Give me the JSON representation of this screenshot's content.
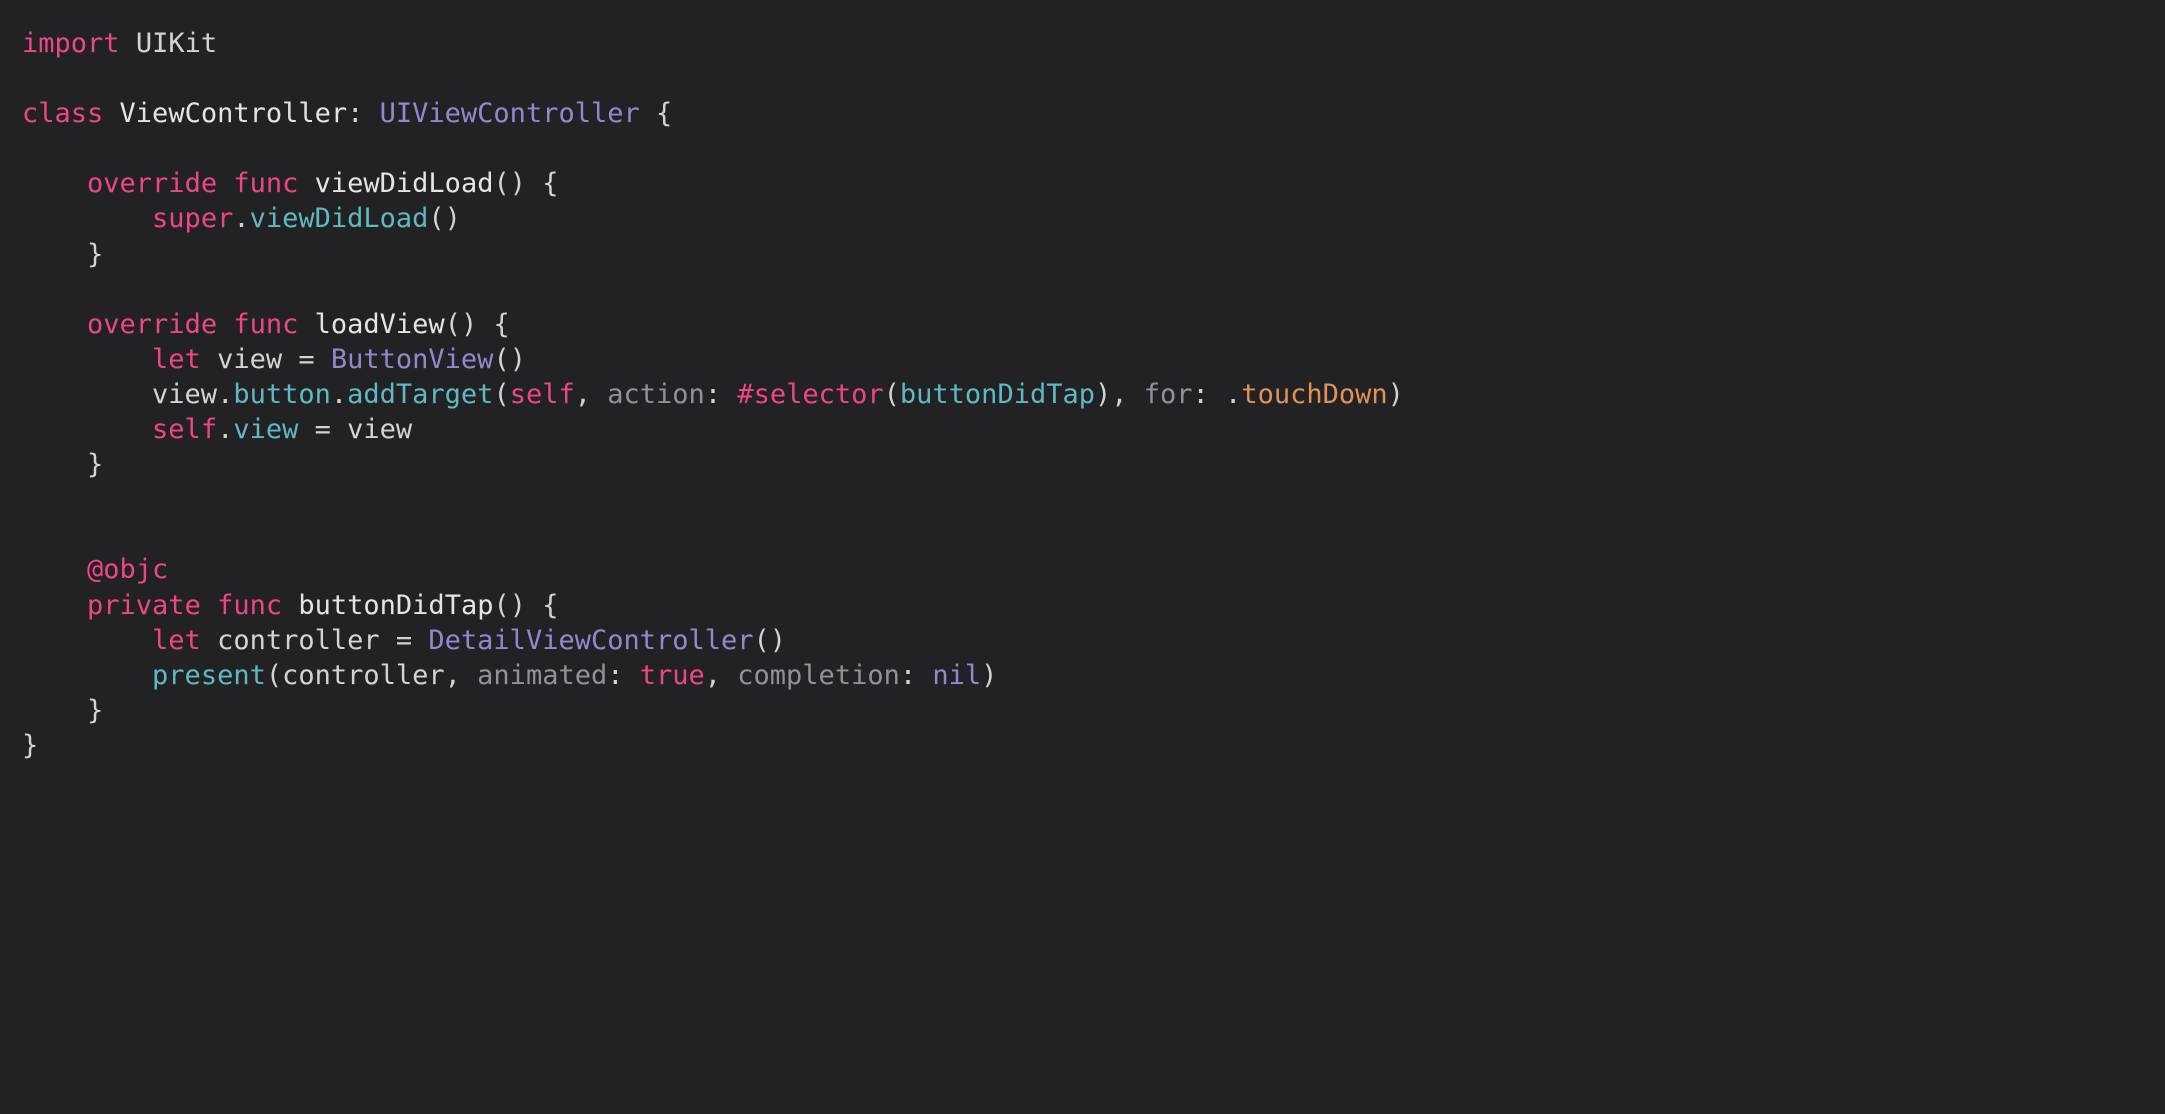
{
  "colors": {
    "keyword": "#ec4689",
    "plain": "#d1d3d4",
    "type": "#9786cd",
    "method": "#5fb9c2",
    "param": "#8e939b",
    "accessor": "#e2e5e7",
    "objc": "#df9355",
    "nil": "#9786cd",
    "punct": "#d1d3d4"
  },
  "code": [
    [
      {
        "t": "import",
        "c": "keyword"
      },
      {
        "t": " ",
        "c": "plain"
      },
      {
        "t": "UIKit",
        "c": "plain"
      }
    ],
    [],
    [
      {
        "t": "class",
        "c": "keyword"
      },
      {
        "t": " ",
        "c": "plain"
      },
      {
        "t": "ViewController",
        "c": "accessor"
      },
      {
        "t": ": ",
        "c": "plain"
      },
      {
        "t": "UIViewController",
        "c": "type"
      },
      {
        "t": " {",
        "c": "plain"
      }
    ],
    [],
    [
      {
        "t": "    ",
        "c": "plain"
      },
      {
        "t": "override",
        "c": "keyword"
      },
      {
        "t": " ",
        "c": "plain"
      },
      {
        "t": "func",
        "c": "keyword"
      },
      {
        "t": " ",
        "c": "plain"
      },
      {
        "t": "viewDidLoad",
        "c": "accessor"
      },
      {
        "t": "() {",
        "c": "plain"
      }
    ],
    [
      {
        "t": "        ",
        "c": "plain"
      },
      {
        "t": "super",
        "c": "keyword"
      },
      {
        "t": ".",
        "c": "plain"
      },
      {
        "t": "viewDidLoad",
        "c": "method"
      },
      {
        "t": "()",
        "c": "plain"
      }
    ],
    [
      {
        "t": "    }",
        "c": "plain"
      }
    ],
    [],
    [
      {
        "t": "    ",
        "c": "plain"
      },
      {
        "t": "override",
        "c": "keyword"
      },
      {
        "t": " ",
        "c": "plain"
      },
      {
        "t": "func",
        "c": "keyword"
      },
      {
        "t": " ",
        "c": "plain"
      },
      {
        "t": "loadView",
        "c": "accessor"
      },
      {
        "t": "() {",
        "c": "plain"
      }
    ],
    [
      {
        "t": "        ",
        "c": "plain"
      },
      {
        "t": "let",
        "c": "keyword"
      },
      {
        "t": " view = ",
        "c": "plain"
      },
      {
        "t": "ButtonView",
        "c": "type"
      },
      {
        "t": "()",
        "c": "plain"
      }
    ],
    [
      {
        "t": "        view.",
        "c": "plain"
      },
      {
        "t": "button",
        "c": "method"
      },
      {
        "t": ".",
        "c": "plain"
      },
      {
        "t": "addTarget",
        "c": "method"
      },
      {
        "t": "(",
        "c": "plain"
      },
      {
        "t": "self",
        "c": "keyword"
      },
      {
        "t": ", ",
        "c": "plain"
      },
      {
        "t": "action",
        "c": "param"
      },
      {
        "t": ": ",
        "c": "plain"
      },
      {
        "t": "#selector",
        "c": "keyword"
      },
      {
        "t": "(",
        "c": "plain"
      },
      {
        "t": "buttonDidTap",
        "c": "method"
      },
      {
        "t": "), ",
        "c": "plain"
      },
      {
        "t": "for",
        "c": "param"
      },
      {
        "t": ": .",
        "c": "plain"
      },
      {
        "t": "touchDown",
        "c": "objc"
      },
      {
        "t": ")",
        "c": "plain"
      }
    ],
    [
      {
        "t": "        ",
        "c": "plain"
      },
      {
        "t": "self",
        "c": "keyword"
      },
      {
        "t": ".",
        "c": "plain"
      },
      {
        "t": "view",
        "c": "method"
      },
      {
        "t": " = view",
        "c": "plain"
      }
    ],
    [
      {
        "t": "    }",
        "c": "plain"
      }
    ],
    [],
    [],
    [
      {
        "t": "    ",
        "c": "plain"
      },
      {
        "t": "@objc",
        "c": "keyword"
      }
    ],
    [
      {
        "t": "    ",
        "c": "plain"
      },
      {
        "t": "private",
        "c": "keyword"
      },
      {
        "t": " ",
        "c": "plain"
      },
      {
        "t": "func",
        "c": "keyword"
      },
      {
        "t": " ",
        "c": "plain"
      },
      {
        "t": "buttonDidTap",
        "c": "accessor"
      },
      {
        "t": "() {",
        "c": "plain"
      }
    ],
    [
      {
        "t": "        ",
        "c": "plain"
      },
      {
        "t": "let",
        "c": "keyword"
      },
      {
        "t": " controller = ",
        "c": "plain"
      },
      {
        "t": "DetailViewController",
        "c": "type"
      },
      {
        "t": "()",
        "c": "plain"
      }
    ],
    [
      {
        "t": "        ",
        "c": "plain"
      },
      {
        "t": "present",
        "c": "method"
      },
      {
        "t": "(controller, ",
        "c": "plain"
      },
      {
        "t": "animated",
        "c": "param"
      },
      {
        "t": ": ",
        "c": "plain"
      },
      {
        "t": "true",
        "c": "keyword"
      },
      {
        "t": ", ",
        "c": "plain"
      },
      {
        "t": "completion",
        "c": "param"
      },
      {
        "t": ": ",
        "c": "plain"
      },
      {
        "t": "nil",
        "c": "nil"
      },
      {
        "t": ")",
        "c": "plain"
      }
    ],
    [
      {
        "t": "    }",
        "c": "plain"
      }
    ],
    [
      {
        "t": "}",
        "c": "plain"
      }
    ]
  ]
}
